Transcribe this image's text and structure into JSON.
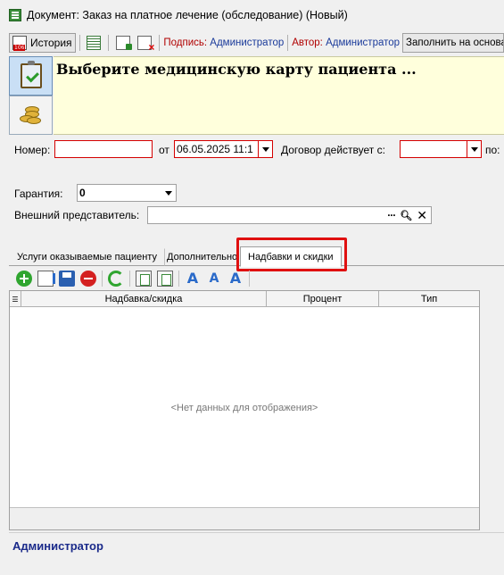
{
  "window": {
    "title": "Документ: Заказ на платное лечение (обследование) (Новый)"
  },
  "toolbar": {
    "history_label": "История",
    "signature_key": "Подпись:",
    "signature_value": "Администратор",
    "author_key": "Автор:",
    "author_value": "Администратор",
    "fill_button_label": "Заполнить на основа"
  },
  "banner": {
    "prompt": "Выберите медицинскую карту пациента ..."
  },
  "form": {
    "number_label": "Номер:",
    "number_value": "",
    "from_label": "от",
    "date_value": "06.05.2025 11:1",
    "contract_label": "Договор действует с:",
    "contract_from_value": "",
    "to_label": "по:",
    "guarantee_label": "Гарантия:",
    "guarantee_value": "0",
    "representative_label": "Внешний представитель:",
    "representative_value": ""
  },
  "tabs": [
    {
      "label": "Услуги оказываемые пациенту"
    },
    {
      "label": "Дополнительно"
    },
    {
      "label": "Надбавки и скидки"
    }
  ],
  "grid": {
    "columns": [
      "Надбавка/скидка",
      "Процент",
      "Тип"
    ],
    "empty_text": "<Нет данных для отображения>"
  },
  "status": {
    "user": "Администратор"
  },
  "colors": {
    "highlight": "#e01010",
    "banner_bg": "#ffffdc",
    "required_border": "#d40000"
  }
}
